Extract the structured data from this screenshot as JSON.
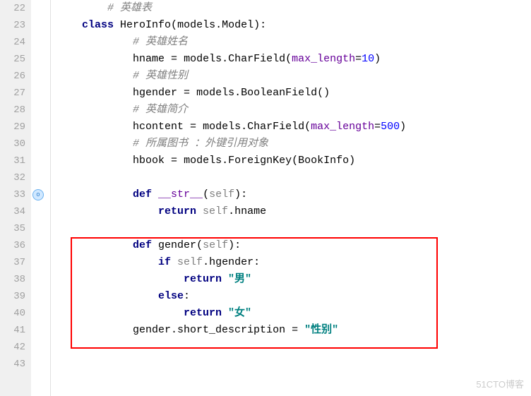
{
  "lines": [
    {
      "n": 22,
      "tokens": [
        [
          "        ",
          "plain"
        ],
        [
          "# 英雄表",
          "cm"
        ]
      ]
    },
    {
      "n": 23,
      "tokens": [
        [
          "    ",
          "plain"
        ],
        [
          "class ",
          "kw"
        ],
        [
          "HeroInfo",
          "plain"
        ],
        [
          "(",
          "plain"
        ],
        [
          "models",
          "plain"
        ],
        [
          ".",
          "plain"
        ],
        [
          "Model",
          "plain"
        ],
        [
          "):",
          "plain"
        ]
      ]
    },
    {
      "n": 24,
      "tokens": [
        [
          "            ",
          "plain"
        ],
        [
          "# 英雄姓名",
          "cm"
        ]
      ]
    },
    {
      "n": 25,
      "tokens": [
        [
          "            ",
          "plain"
        ],
        [
          "hname ",
          "plain"
        ],
        [
          "= ",
          "plain"
        ],
        [
          "models.CharField(",
          "plain"
        ],
        [
          "max_length",
          "mag"
        ],
        [
          "=",
          "plain"
        ],
        [
          "10",
          "num"
        ],
        [
          ")",
          "plain"
        ]
      ]
    },
    {
      "n": 26,
      "tokens": [
        [
          "            ",
          "plain"
        ],
        [
          "# 英雄性别",
          "cm"
        ]
      ]
    },
    {
      "n": 27,
      "tokens": [
        [
          "            ",
          "plain"
        ],
        [
          "hgender ",
          "plain"
        ],
        [
          "= ",
          "plain"
        ],
        [
          "models.BooleanField()",
          "plain"
        ]
      ]
    },
    {
      "n": 28,
      "tokens": [
        [
          "            ",
          "plain"
        ],
        [
          "# 英雄简介",
          "cm"
        ]
      ]
    },
    {
      "n": 29,
      "tokens": [
        [
          "            ",
          "plain"
        ],
        [
          "hcontent ",
          "plain"
        ],
        [
          "= ",
          "plain"
        ],
        [
          "models.CharField(",
          "plain"
        ],
        [
          "max_length",
          "mag"
        ],
        [
          "=",
          "plain"
        ],
        [
          "500",
          "num"
        ],
        [
          ")",
          "plain"
        ]
      ]
    },
    {
      "n": 30,
      "tokens": [
        [
          "            ",
          "plain"
        ],
        [
          "# 所属图书 ：外键引用对象",
          "cm"
        ]
      ]
    },
    {
      "n": 31,
      "tokens": [
        [
          "            ",
          "plain"
        ],
        [
          "hbook ",
          "plain"
        ],
        [
          "= ",
          "plain"
        ],
        [
          "models.ForeignKey(BookInfo)",
          "plain"
        ]
      ]
    },
    {
      "n": 32,
      "tokens": [
        [
          "",
          "plain"
        ]
      ]
    },
    {
      "n": 33,
      "tokens": [
        [
          "            ",
          "plain"
        ],
        [
          "def ",
          "kw"
        ],
        [
          "__str__",
          "mag"
        ],
        [
          "(",
          "plain"
        ],
        [
          "self",
          "param"
        ],
        [
          "):",
          "plain"
        ]
      ],
      "override": true
    },
    {
      "n": 34,
      "tokens": [
        [
          "                ",
          "plain"
        ],
        [
          "return ",
          "kw"
        ],
        [
          "self",
          "param"
        ],
        [
          ".hname",
          "plain"
        ]
      ]
    },
    {
      "n": 35,
      "tokens": [
        [
          "",
          "plain"
        ]
      ]
    },
    {
      "n": 36,
      "tokens": [
        [
          "            ",
          "plain"
        ],
        [
          "def ",
          "kw"
        ],
        [
          "gender",
          "fn"
        ],
        [
          "(",
          "plain"
        ],
        [
          "self",
          "param"
        ],
        [
          "):",
          "plain"
        ]
      ]
    },
    {
      "n": 37,
      "tokens": [
        [
          "                ",
          "plain"
        ],
        [
          "if ",
          "kw"
        ],
        [
          "self",
          "param"
        ],
        [
          ".hgender:",
          "plain"
        ]
      ]
    },
    {
      "n": 38,
      "tokens": [
        [
          "                    ",
          "plain"
        ],
        [
          "return ",
          "kw"
        ],
        [
          "\"男\"",
          "str"
        ]
      ]
    },
    {
      "n": 39,
      "tokens": [
        [
          "                ",
          "plain"
        ],
        [
          "else",
          "kw"
        ],
        [
          ":",
          "plain"
        ]
      ]
    },
    {
      "n": 40,
      "tokens": [
        [
          "                    ",
          "plain"
        ],
        [
          "return ",
          "kw"
        ],
        [
          "\"女\"",
          "str"
        ]
      ]
    },
    {
      "n": 41,
      "tokens": [
        [
          "            ",
          "plain"
        ],
        [
          "gender.short_description = ",
          "plain"
        ],
        [
          "\"性别\"",
          "str"
        ]
      ]
    },
    {
      "n": 42,
      "tokens": [
        [
          "",
          "plain"
        ]
      ]
    },
    {
      "n": 43,
      "tokens": [
        [
          "",
          "plain"
        ]
      ]
    }
  ],
  "watermark": "51CTO博客"
}
